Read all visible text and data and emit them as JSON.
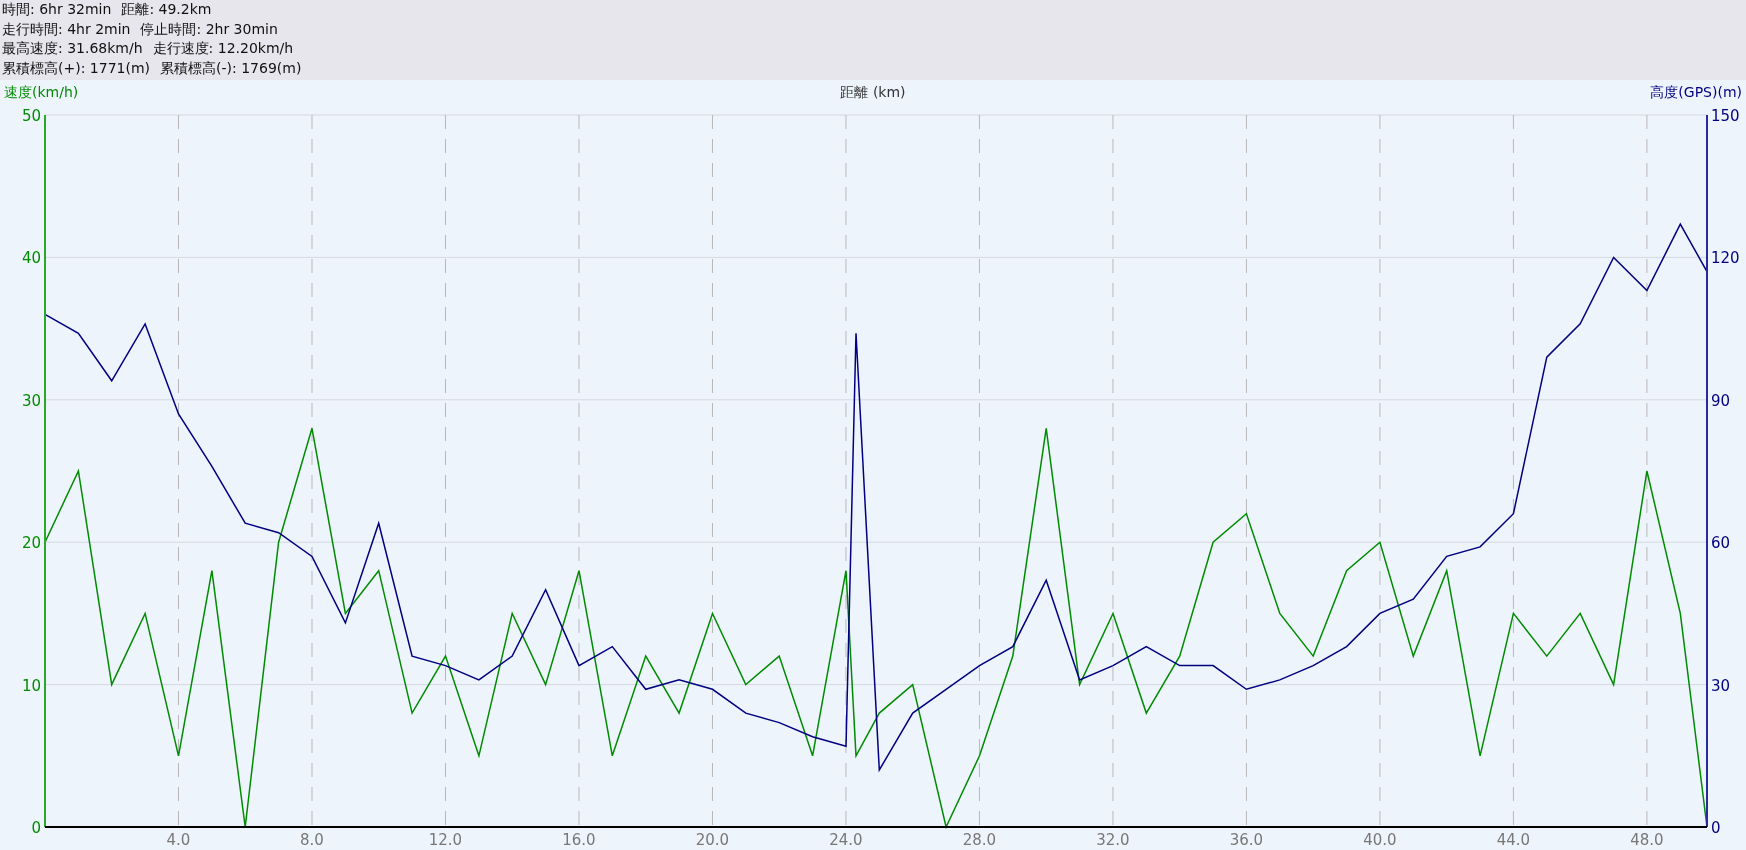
{
  "summary": [
    {
      "items": [
        "時間: 6hr 32min",
        "距離: 49.2km"
      ]
    },
    {
      "items": [
        "走行時間: 4hr 2min",
        "停止時間: 2hr 30min"
      ]
    },
    {
      "items": [
        "最高速度: 31.68km/h",
        "走行速度: 12.20km/h"
      ]
    },
    {
      "items": [
        "累積標高(+): 1771(m)",
        "累積標高(-): 1769(m)"
      ]
    }
  ],
  "chart": {
    "chart_data": {
      "type": "line",
      "grid": true,
      "xlabel": "距離 (km)",
      "ylabel": "速度(km/h)",
      "y2label": "高度(GPS)(m)",
      "x": [
        0,
        1,
        2,
        3,
        4,
        5,
        6,
        7,
        8,
        9,
        10,
        11,
        12,
        13,
        14,
        15,
        16,
        17,
        18,
        19,
        20,
        21,
        22,
        23,
        24,
        24.3,
        25,
        26,
        27,
        28,
        29,
        30,
        31,
        32,
        33,
        34,
        35,
        36,
        37,
        38,
        39,
        40,
        41,
        42,
        43,
        44,
        45,
        46,
        47,
        48,
        49,
        49.8
      ],
      "xlim": [
        0,
        49.8
      ],
      "ylim": [
        0,
        50
      ],
      "y2lim": [
        0,
        150
      ],
      "xticks": [
        {
          "value": 4,
          "label": "4.0"
        },
        {
          "value": 8,
          "label": "8.0"
        },
        {
          "value": 12,
          "label": "12.0"
        },
        {
          "value": 16,
          "label": "16.0"
        },
        {
          "value": 20,
          "label": "20.0"
        },
        {
          "value": 24,
          "label": "24.0"
        },
        {
          "value": 28,
          "label": "28.0"
        },
        {
          "value": 32,
          "label": "32.0"
        },
        {
          "value": 36,
          "label": "36.0"
        },
        {
          "value": 40,
          "label": "40.0"
        },
        {
          "value": 44,
          "label": "44.0"
        },
        {
          "value": 48,
          "label": "48.0"
        }
      ],
      "yticks": [
        0,
        10,
        20,
        30,
        40,
        50
      ],
      "y2ticks": [
        0,
        30,
        60,
        90,
        120,
        150
      ],
      "series": [
        {
          "color": "#008c00",
          "values": [
            20,
            25,
            10,
            15,
            5,
            18,
            0,
            20,
            28,
            15,
            18,
            8,
            12,
            5,
            15,
            10,
            18,
            5,
            12,
            8,
            15,
            10,
            12,
            5,
            18,
            5,
            8,
            10,
            0,
            5,
            12,
            28,
            10,
            15,
            8,
            12,
            20,
            22,
            15,
            12,
            18,
            20,
            12,
            18,
            5,
            15,
            12,
            15,
            10,
            25,
            15,
            0
          ]
        },
        {
          "color": "#000080",
          "axis": "y2",
          "values": [
            108,
            104,
            94,
            106,
            87,
            76,
            64,
            62,
            57,
            43,
            64,
            36,
            34,
            31,
            36,
            50,
            34,
            38,
            29,
            31,
            29,
            24,
            22,
            19,
            17,
            104,
            12,
            24,
            29,
            34,
            38,
            52,
            31,
            34,
            38,
            34,
            34,
            29,
            31,
            34,
            38,
            45,
            48,
            57,
            59,
            66,
            99,
            106,
            120,
            113,
            127,
            117
          ]
        }
      ]
    }
  }
}
